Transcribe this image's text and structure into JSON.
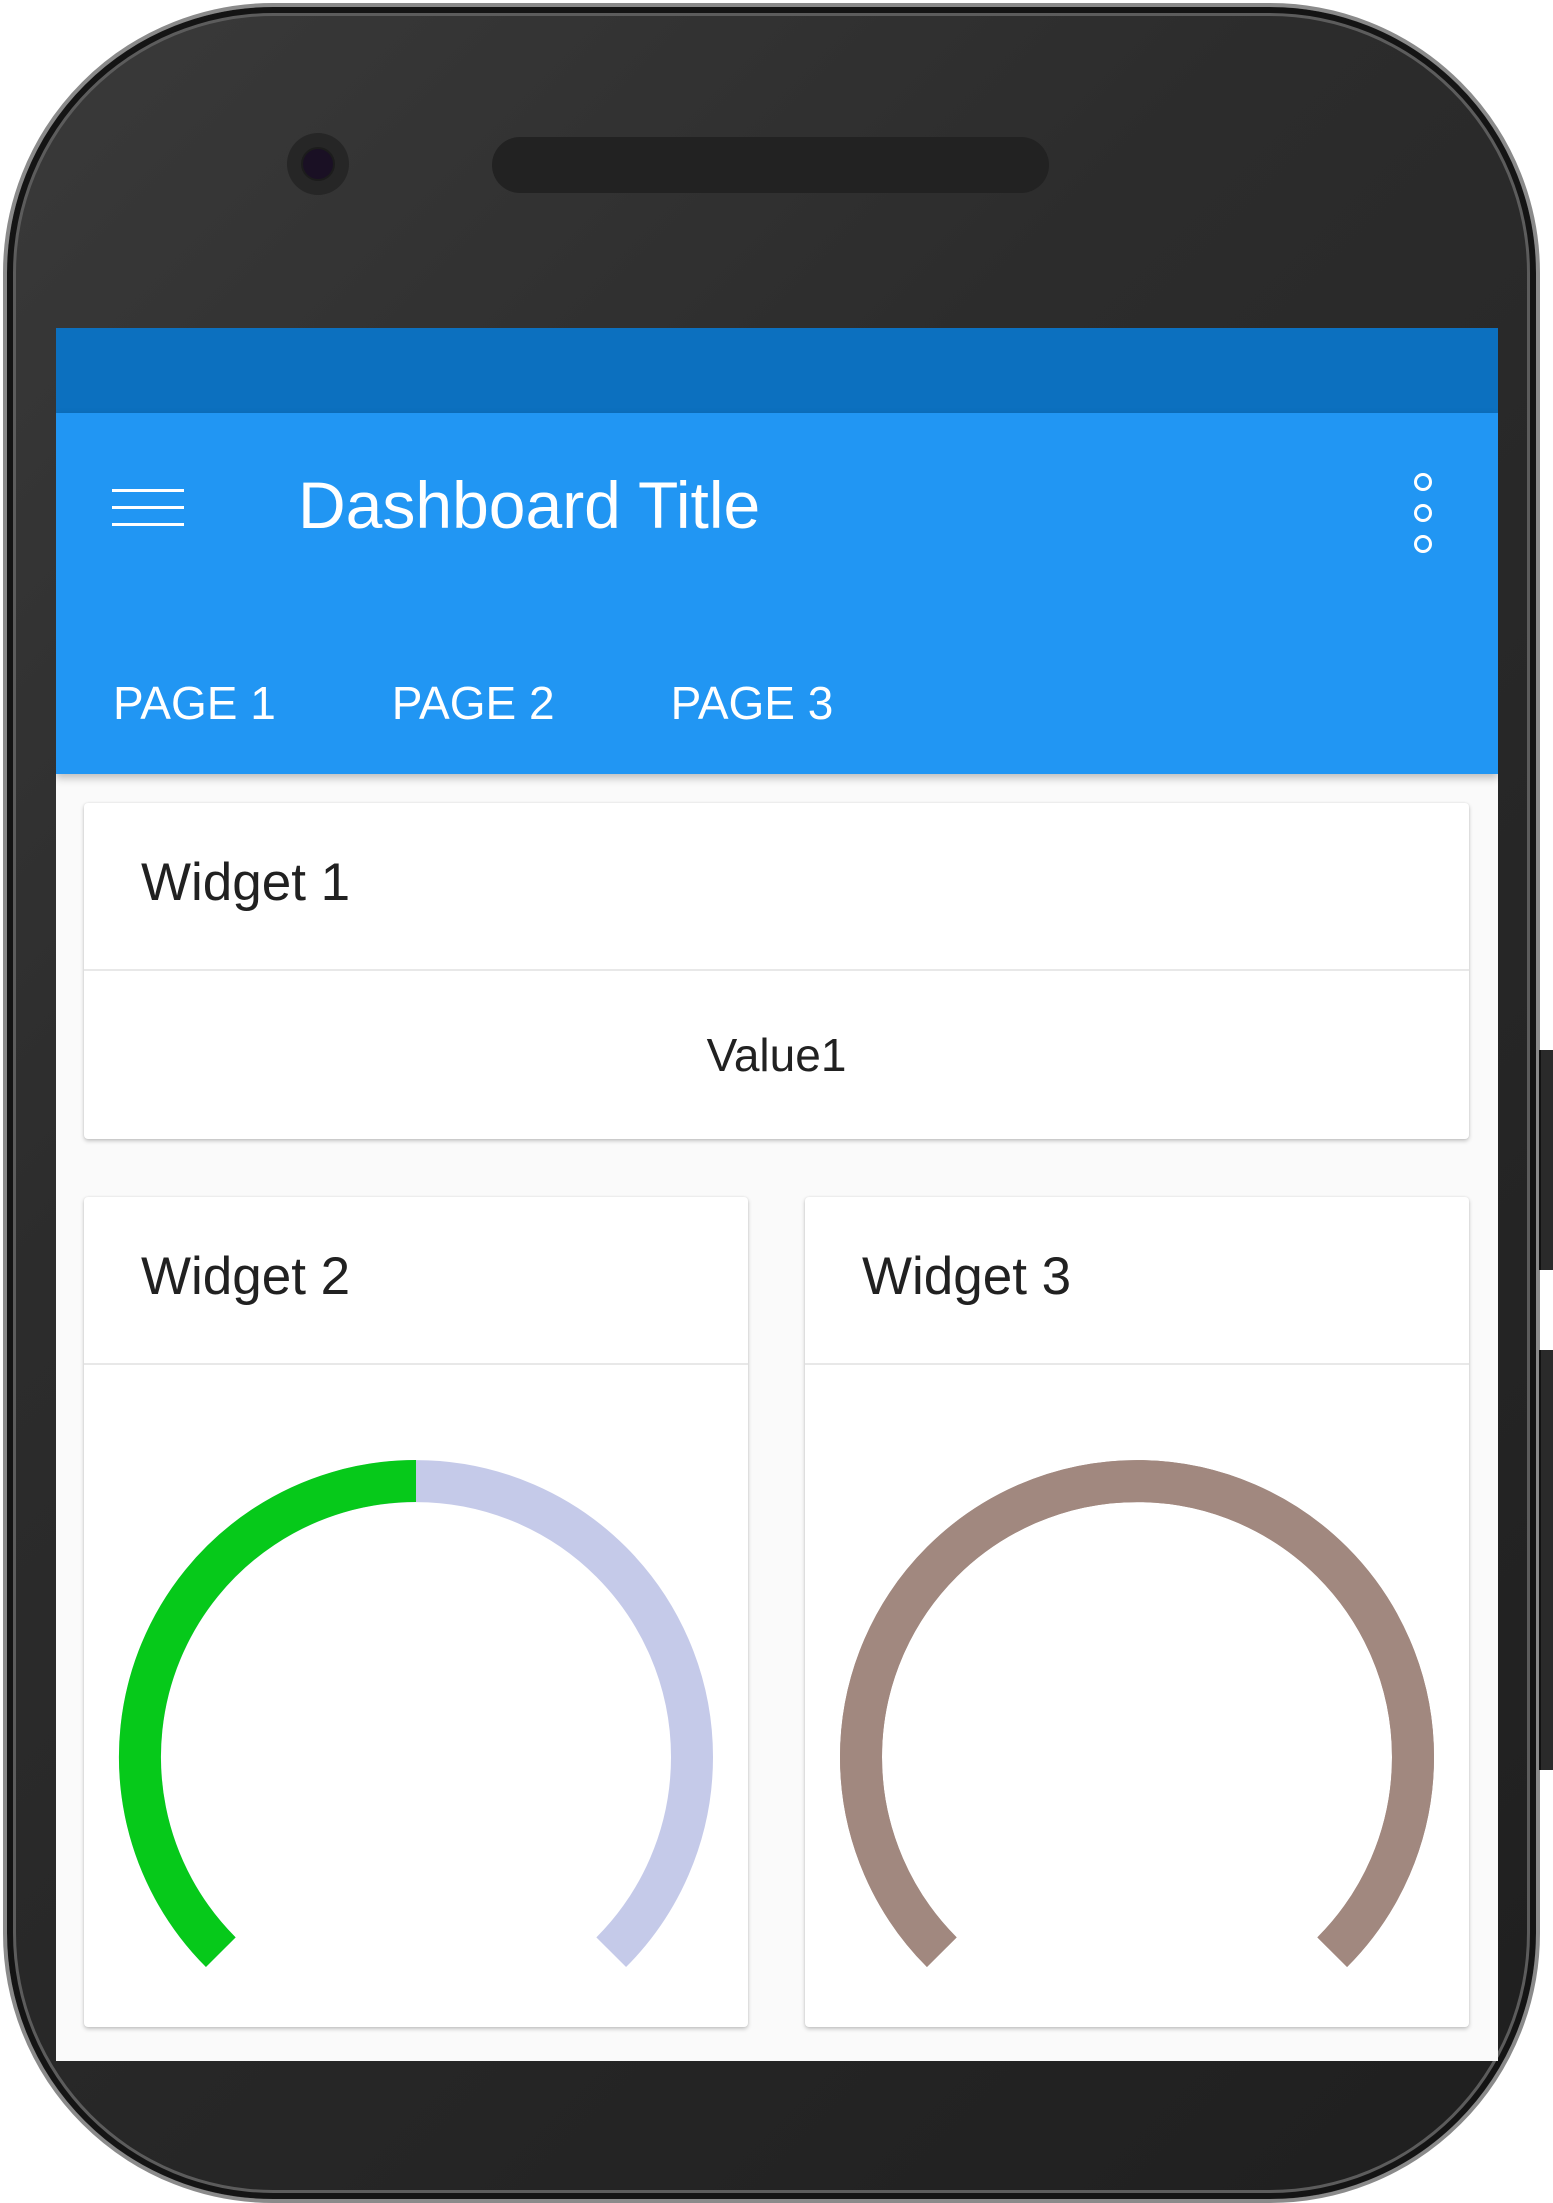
{
  "app": {
    "title": "Dashboard Title",
    "menu_icon": "hamburger-menu-icon",
    "more_icon": "more-vertical-icon"
  },
  "tabs": [
    {
      "label": "PAGE 1"
    },
    {
      "label": "PAGE 2"
    },
    {
      "label": "PAGE 3"
    }
  ],
  "widgets": [
    {
      "title": "Widget 1",
      "value": "Value1"
    },
    {
      "title": "Widget 2",
      "gauge_fraction": 0.5,
      "fill_color": "#06c91a",
      "track_color": "#c5cae9"
    },
    {
      "title": "Widget 3",
      "gauge_fraction": 1.0,
      "fill_color": "#a1887f",
      "track_color": "#a1887f"
    }
  ],
  "colors": {
    "status_bar": "#0c70bf",
    "app_bar": "#2196f3",
    "screen_bg": "#fafafa"
  }
}
